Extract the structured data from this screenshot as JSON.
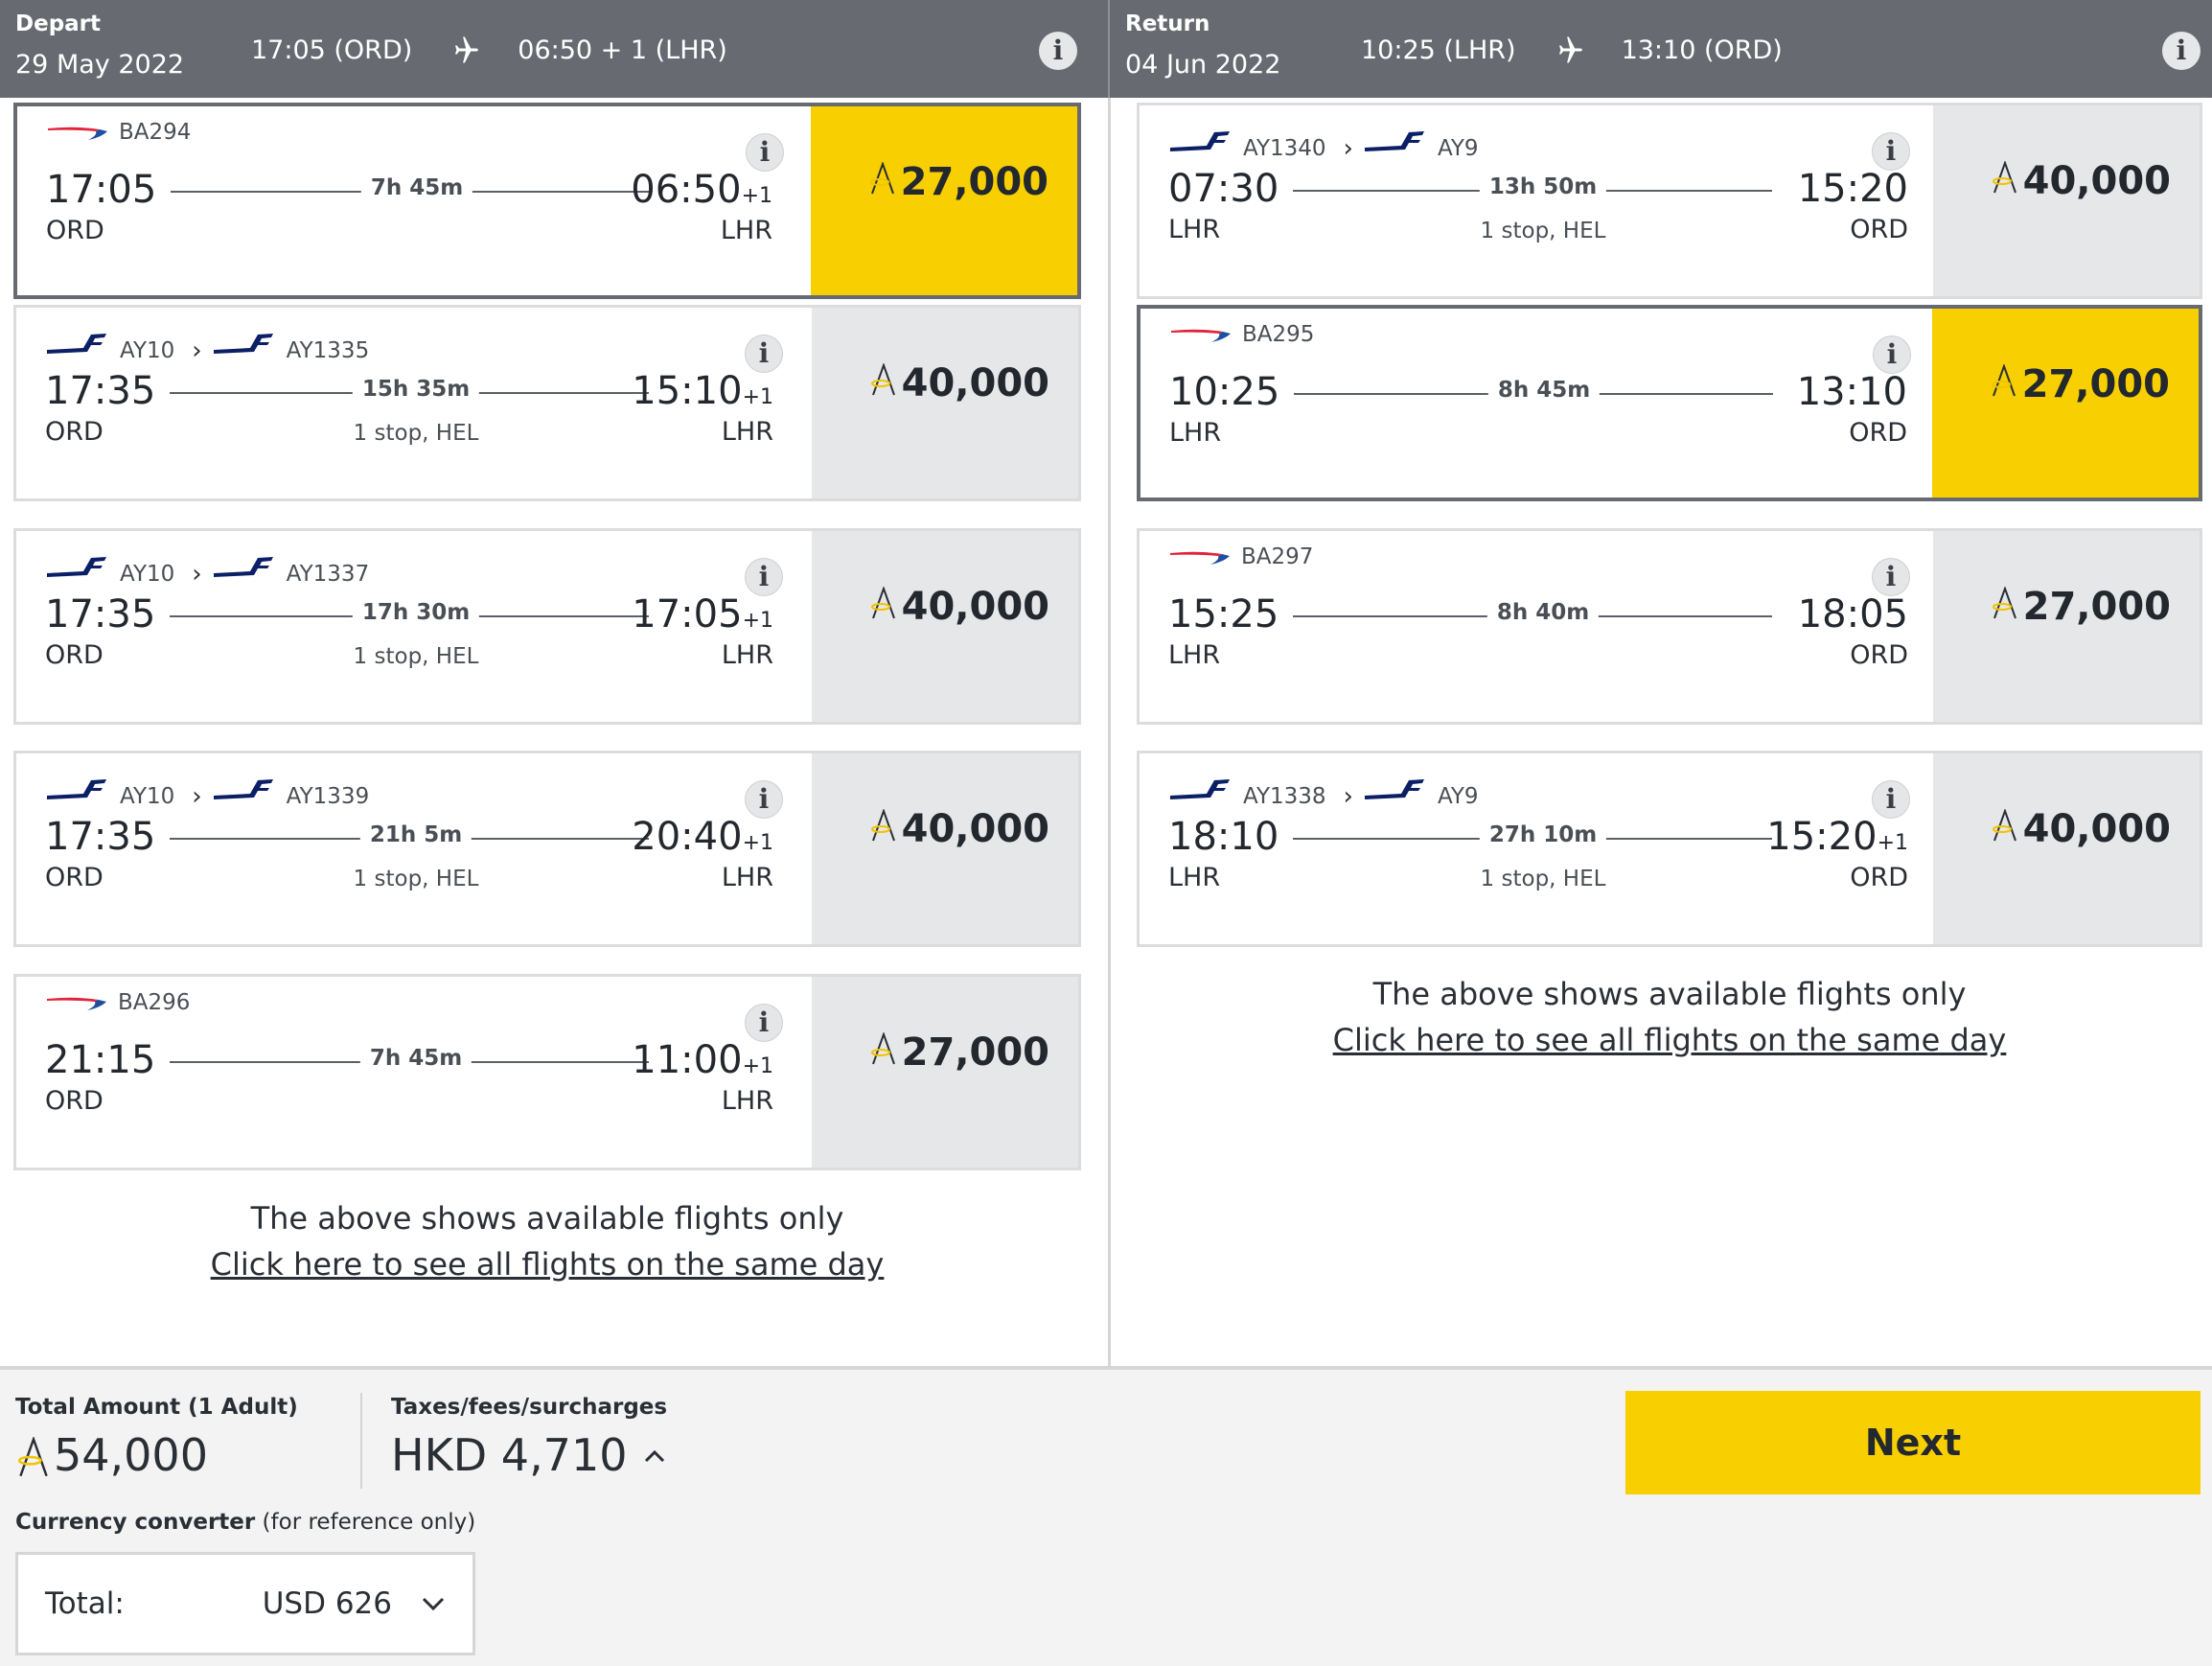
{
  "depart_header": {
    "label": "Depart",
    "date": "29 May 2022",
    "dep": "17:05 (ORD)",
    "arr": "06:50 + 1 (LHR)"
  },
  "return_header": {
    "label": "Return",
    "date": "04 Jun 2022",
    "dep": "10:25 (LHR)",
    "arr": "13:10 (ORD)"
  },
  "colors": {
    "header_bg": "#676b71",
    "selected_price_bg": "#f8cf00",
    "price_bg": "#e6e7e9",
    "next_button": "#f8cf00"
  },
  "depart_flights": [
    {
      "airline": "BA",
      "codes": [
        "BA294"
      ],
      "dep_time": "17:05",
      "dep_ap": "ORD",
      "duration": "7h 45m",
      "stops": "",
      "arr_time": "06:50",
      "arr_plus": "+1",
      "arr_ap": "LHR",
      "price": "27,000",
      "selected": true
    },
    {
      "airline": "AY",
      "codes": [
        "AY10",
        "AY1335"
      ],
      "dep_time": "17:35",
      "dep_ap": "ORD",
      "duration": "15h 35m",
      "stops": "1 stop, HEL",
      "arr_time": "15:10",
      "arr_plus": "+1",
      "arr_ap": "LHR",
      "price": "40,000",
      "selected": false
    },
    {
      "airline": "AY",
      "codes": [
        "AY10",
        "AY1337"
      ],
      "dep_time": "17:35",
      "dep_ap": "ORD",
      "duration": "17h 30m",
      "stops": "1 stop, HEL",
      "arr_time": "17:05",
      "arr_plus": "+1",
      "arr_ap": "LHR",
      "price": "40,000",
      "selected": false
    },
    {
      "airline": "AY",
      "codes": [
        "AY10",
        "AY1339"
      ],
      "dep_time": "17:35",
      "dep_ap": "ORD",
      "duration": "21h 5m",
      "stops": "1 stop, HEL",
      "arr_time": "20:40",
      "arr_plus": "+1",
      "arr_ap": "LHR",
      "price": "40,000",
      "selected": false
    },
    {
      "airline": "BA",
      "codes": [
        "BA296"
      ],
      "dep_time": "21:15",
      "dep_ap": "ORD",
      "duration": "7h 45m",
      "stops": "",
      "arr_time": "11:00",
      "arr_plus": "+1",
      "arr_ap": "LHR",
      "price": "27,000",
      "selected": false
    }
  ],
  "return_flights": [
    {
      "airline": "AY",
      "codes": [
        "AY1340",
        "AY9"
      ],
      "dep_time": "07:30",
      "dep_ap": "LHR",
      "duration": "13h 50m",
      "stops": "1 stop, HEL",
      "arr_time": "15:20",
      "arr_plus": "",
      "arr_ap": "ORD",
      "price": "40,000",
      "selected": false
    },
    {
      "airline": "BA",
      "codes": [
        "BA295"
      ],
      "dep_time": "10:25",
      "dep_ap": "LHR",
      "duration": "8h 45m",
      "stops": "",
      "arr_time": "13:10",
      "arr_plus": "",
      "arr_ap": "ORD",
      "price": "27,000",
      "selected": true
    },
    {
      "airline": "BA",
      "codes": [
        "BA297"
      ],
      "dep_time": "15:25",
      "dep_ap": "LHR",
      "duration": "8h 40m",
      "stops": "",
      "arr_time": "18:05",
      "arr_plus": "",
      "arr_ap": "ORD",
      "price": "27,000",
      "selected": false
    },
    {
      "airline": "AY",
      "codes": [
        "AY1338",
        "AY9"
      ],
      "dep_time": "18:10",
      "dep_ap": "LHR",
      "duration": "27h 10m",
      "stops": "1 stop, HEL",
      "arr_time": "15:20",
      "arr_plus": "+1",
      "arr_ap": "ORD",
      "price": "40,000",
      "selected": false
    }
  ],
  "note": {
    "message": "The above shows available flights only",
    "link": "Click here to see all flights on the same day"
  },
  "footer": {
    "total_label": "Total Amount (1 Adult)",
    "total_value": "54,000",
    "tax_label": "Taxes/fees/surcharges",
    "tax_value": "HKD 4,710",
    "converter_label_bold": "Currency converter",
    "converter_label_rest": " (for reference only)",
    "converter_total_label": "Total:",
    "converter_total_value": "USD 626",
    "next_label": "Next"
  }
}
